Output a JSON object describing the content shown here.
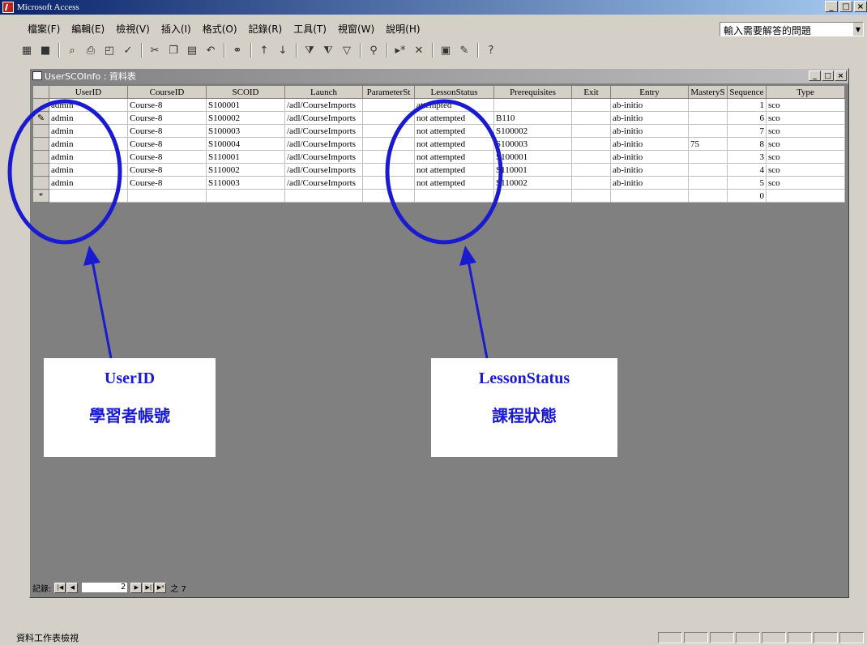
{
  "app": {
    "title": "Microsoft Access"
  },
  "window_controls": [
    "_",
    "□",
    "×"
  ],
  "menu": [
    "檔案(F)",
    "編輯(E)",
    "檢視(V)",
    "插入(I)",
    "格式(O)",
    "記錄(R)",
    "工具(T)",
    "視窗(W)",
    "說明(H)"
  ],
  "help_box": {
    "text": "輸入需要解答的問題"
  },
  "toolbar": {
    "icons": [
      "view-icon",
      "save-icon",
      "search-db-icon",
      "print-icon",
      "print-preview-icon",
      "spelling-icon",
      "cut-icon",
      "copy-icon",
      "paste-icon",
      "undo-icon",
      "hyperlink-icon",
      "sort-asc-icon",
      "sort-desc-icon",
      "filter-selection-icon",
      "filter-form-icon",
      "apply-filter-icon",
      "find-icon",
      "new-record-icon",
      "delete-record-icon",
      "database-window-icon",
      "new-object-icon",
      "help-icon"
    ]
  },
  "datasheet": {
    "title": "UserSCOInfo : 資料表",
    "columns": [
      "UserID",
      "CourseID",
      "SCOID",
      "Launch",
      "ParameterSt",
      "LessonStatus",
      "Prerequisites",
      "Exit",
      "Entry",
      "MasteryS",
      "Sequence",
      "Type"
    ],
    "rows": [
      {
        "selector": "",
        "cells": [
          "admin",
          "Course-8",
          "S100001",
          "/adl/CourseImports",
          "",
          "attempted",
          "",
          "",
          "ab-initio",
          "",
          "1",
          "sco"
        ]
      },
      {
        "selector": "✎",
        "cells": [
          "admin",
          "Course-8",
          "S100002",
          "/adl/CourseImports",
          "",
          "not attempted",
          "B110",
          "",
          "ab-initio",
          "",
          "6",
          "sco"
        ]
      },
      {
        "selector": "",
        "cells": [
          "admin",
          "Course-8",
          "S100003",
          "/adl/CourseImports",
          "",
          "not attempted",
          "S100002",
          "",
          "ab-initio",
          "",
          "7",
          "sco"
        ]
      },
      {
        "selector": "",
        "cells": [
          "admin",
          "Course-8",
          "S100004",
          "/adl/CourseImports",
          "",
          "not attempted",
          "S100003",
          "",
          "ab-initio",
          "75",
          "8",
          "sco"
        ]
      },
      {
        "selector": "",
        "cells": [
          "admin",
          "Course-8",
          "S110001",
          "/adl/CourseImports",
          "",
          "not attempted",
          "S100001",
          "",
          "ab-initio",
          "",
          "3",
          "sco"
        ]
      },
      {
        "selector": "",
        "cells": [
          "admin",
          "Course-8",
          "S110002",
          "/adl/CourseImports",
          "",
          "not attempted",
          "S110001",
          "",
          "ab-initio",
          "",
          "4",
          "sco"
        ]
      },
      {
        "selector": "",
        "cells": [
          "admin",
          "Course-8",
          "S110003",
          "/adl/CourseImports",
          "",
          "not attempted",
          "S110002",
          "",
          "ab-initio",
          "",
          "5",
          "sco"
        ]
      },
      {
        "selector": "*",
        "cells": [
          "",
          "",
          "",
          "",
          "",
          "",
          "",
          "",
          "",
          "",
          "0",
          ""
        ]
      }
    ],
    "nav": {
      "label": "記錄:",
      "current": "2",
      "total_text": "之 7"
    }
  },
  "status": {
    "text": "資料工作表檢視"
  },
  "annotations": [
    {
      "en": "UserID",
      "zh": "學習者帳號"
    },
    {
      "en": "LessonStatus",
      "zh": "課程狀態"
    }
  ],
  "colors": {
    "annotation": "#1a1ad0",
    "title_bar": "#0a246a",
    "face": "#d4d0c8",
    "workspace": "#808080"
  }
}
